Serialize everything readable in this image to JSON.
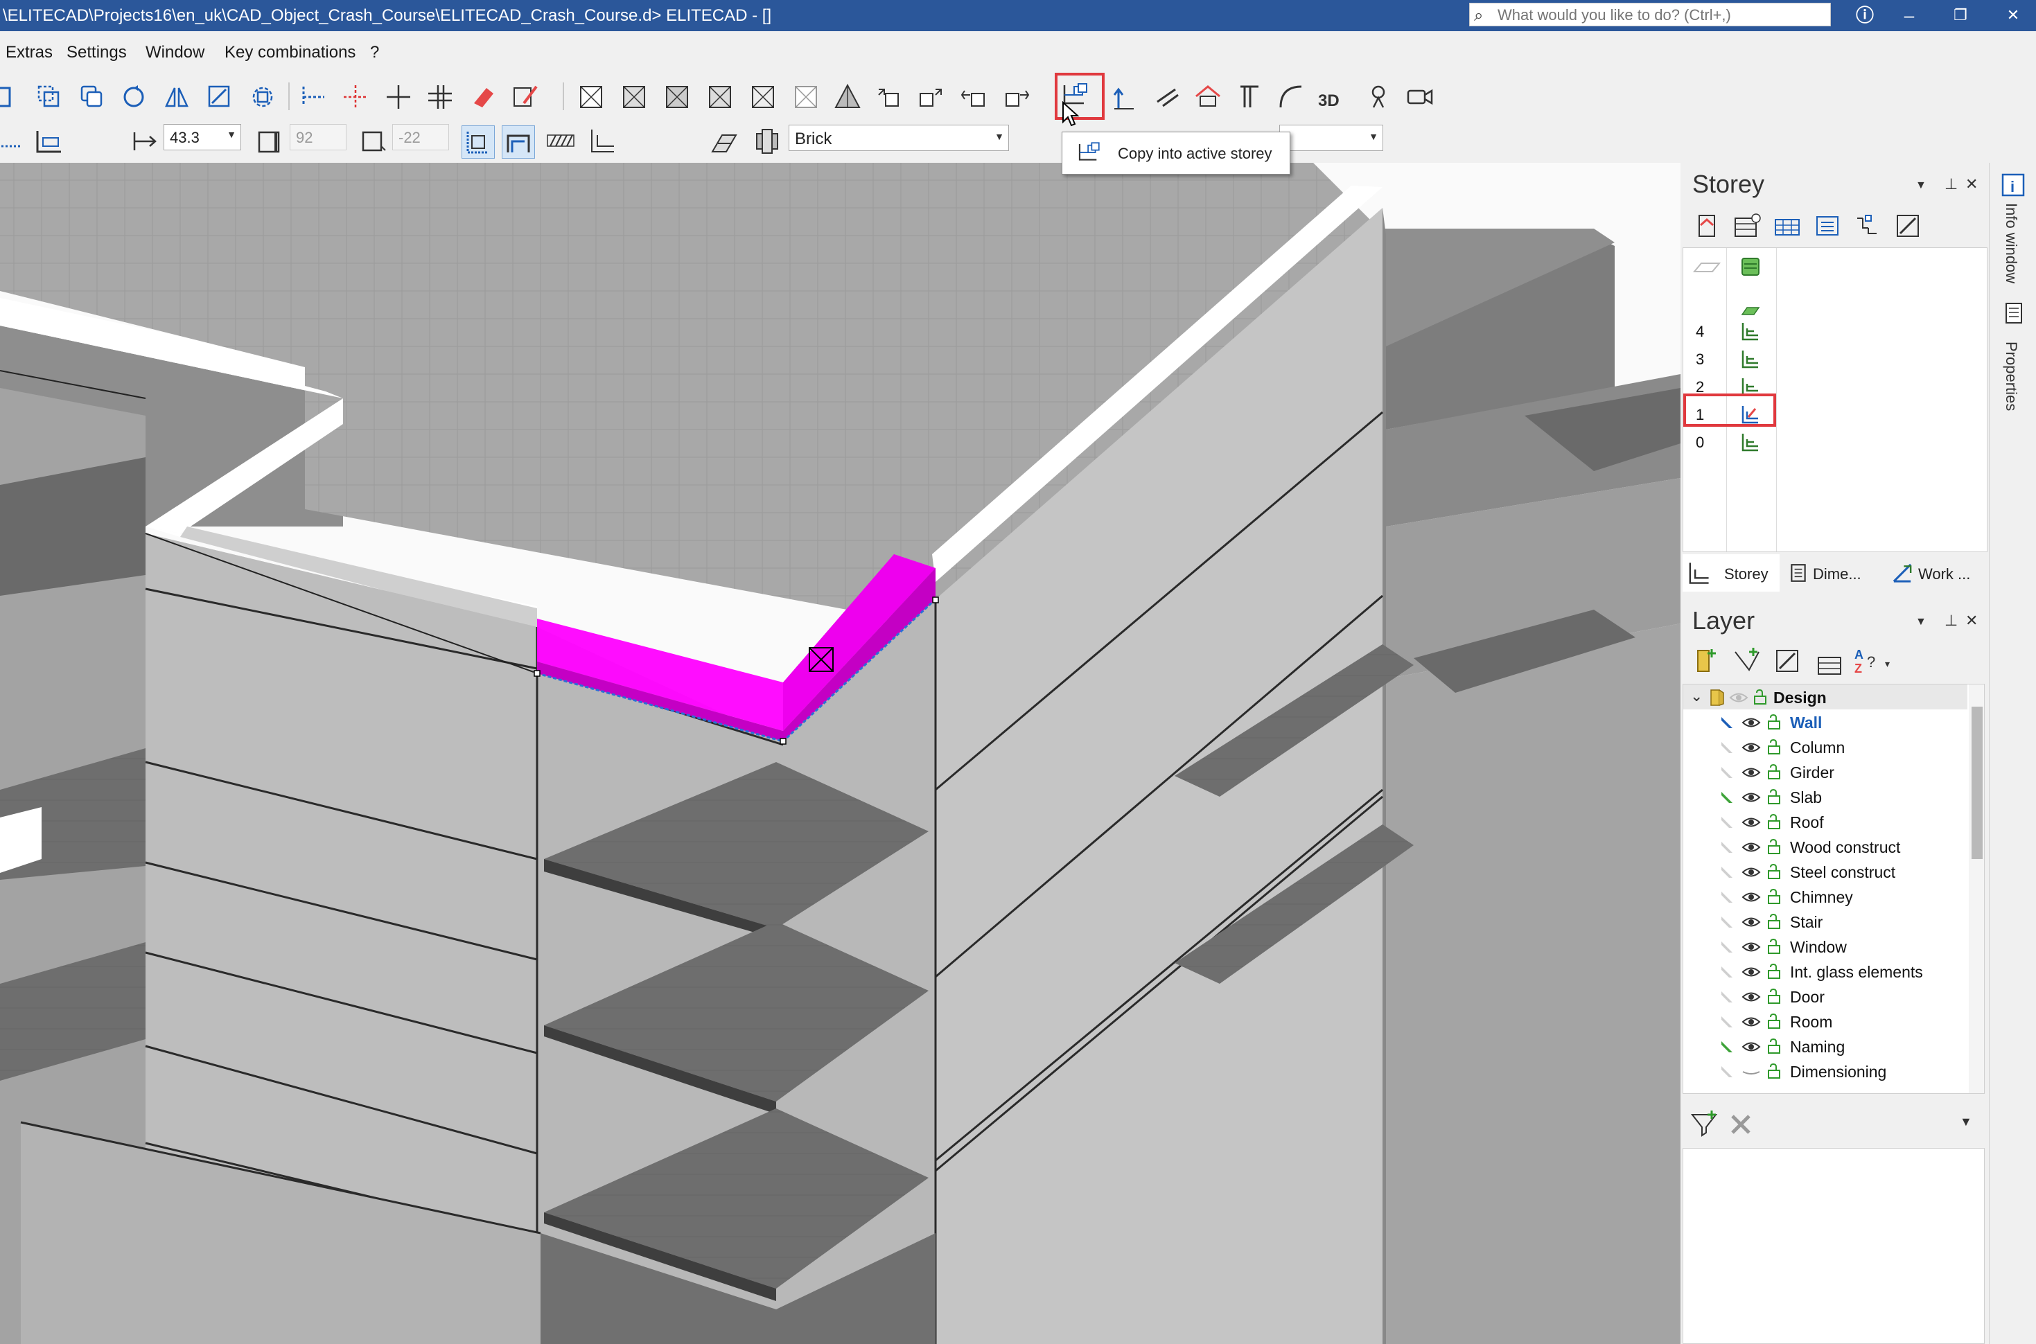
{
  "window": {
    "title": "\\ELITECAD\\Projects16\\en_uk\\CAD_Object_Crash_Course\\ELITECAD_Crash_Course.d> ELITECAD - []",
    "search_placeholder": "What would you like to do? (Ctrl+,)",
    "info_icon": "info-icon",
    "minimize": "–",
    "restore": "❐",
    "close": "✕"
  },
  "menu": {
    "items": [
      "Extras",
      "Settings",
      "Window",
      "Key combinations",
      "?"
    ]
  },
  "toolbar": {
    "thickness": "43.3",
    "height": "92",
    "offset": "-22",
    "material": "Brick",
    "tooltip": "Copy into active storey"
  },
  "storey_panel": {
    "title": "Storey",
    "pin": "📌",
    "close": "✕",
    "rows": [
      "4",
      "3",
      "2",
      "1",
      "0"
    ],
    "active": "1",
    "tabs": [
      "Storey",
      "Dime...",
      "Work ..."
    ]
  },
  "side_tabs": [
    "Info window",
    "Properties"
  ],
  "layer_panel": {
    "title": "Layer",
    "root": "Design",
    "layers": [
      {
        "name": "Wall",
        "active": true
      },
      {
        "name": "Column"
      },
      {
        "name": "Girder"
      },
      {
        "name": "Slab",
        "green": true
      },
      {
        "name": "Roof"
      },
      {
        "name": "Wood construct"
      },
      {
        "name": "Steel construct"
      },
      {
        "name": "Chimney"
      },
      {
        "name": "Stair"
      },
      {
        "name": "Window"
      },
      {
        "name": "Int. glass elements"
      },
      {
        "name": "Door"
      },
      {
        "name": "Room"
      },
      {
        "name": "Naming",
        "green": true
      },
      {
        "name": "Dimensioning",
        "hidden": true
      }
    ]
  },
  "colors": {
    "titlebar": "#2b579a",
    "highlight": "#e0393e",
    "selection": "#ff00ff",
    "active_layer": "#1c5fb8"
  }
}
